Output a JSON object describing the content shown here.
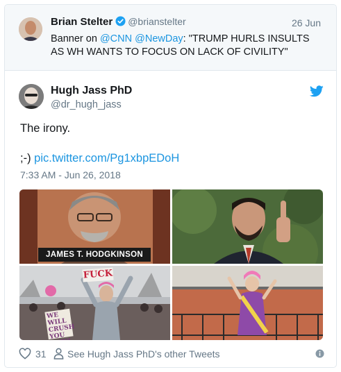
{
  "quoted_tweet": {
    "name": "Brian Stelter",
    "handle": "@brianstelter",
    "date": "26 Jun",
    "text_prefix": "Banner on ",
    "mention1": "@CNN",
    "mention2": "@NewDay",
    "text_suffix": ": \"TRUMP HURLS INSULTS AS WH WANTS TO FOCUS ON LACK OF CIVILITY\""
  },
  "tweet": {
    "name": "Hugh Jass PhD",
    "handle": "@dr_hugh_jass",
    "line1": "The irony.",
    "line2_prefix": ";-) ",
    "link": "pic.twitter.com/Pg1xbpEDoH",
    "timestamp": "7:33 AM - Jun 26, 2018"
  },
  "media": {
    "caption1": "JAMES T. HODGKINSON",
    "sign_text": "FUCK",
    "sign_left_text": "WE WILL CRUSH YOU WITH",
    "icons": [
      "photo-hodgkinson",
      "photo-middle-finger",
      "photo-protest-march",
      "photo-child-protest"
    ]
  },
  "footer": {
    "likes": "31",
    "other_tweets": "See Hugh Jass PhD's other Tweets",
    "icons": [
      "heart-icon",
      "person-icon",
      "info-icon"
    ]
  },
  "colors": {
    "link": "#1b95e0",
    "muted": "#657786",
    "border": "#e1e8ed",
    "quoted_bg": "#f5f8fa"
  }
}
